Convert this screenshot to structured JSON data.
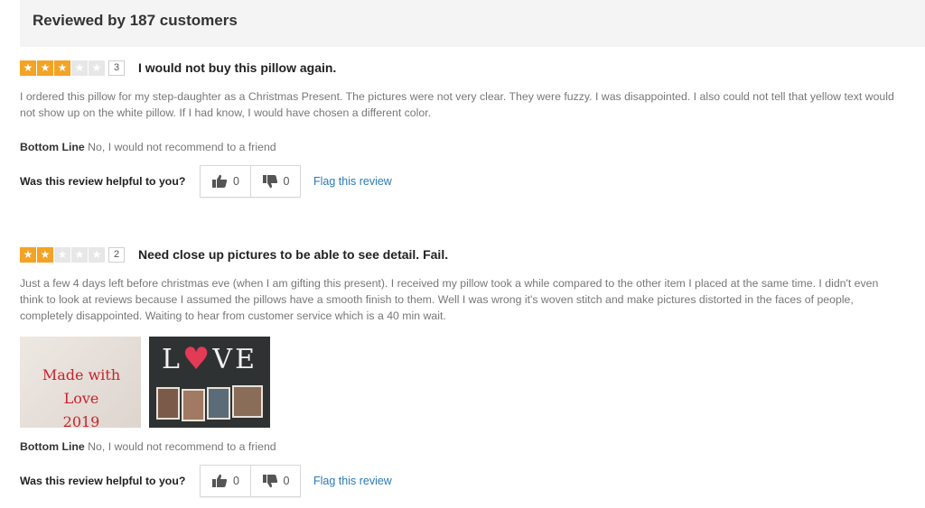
{
  "header": {
    "title": "Reviewed by 187 customers"
  },
  "reviews": [
    {
      "rating": 3,
      "max_rating": 5,
      "rating_label": "3",
      "title": "I would not buy this pillow again.",
      "body": "I ordered this pillow for my step-daughter as a Christmas Present. The pictures were not very clear. They were fuzzy. I was disappointed. I also could not tell that yellow text would not show up on the white pillow. If I had know, I would have chosen a different color.",
      "bottom_line_label": "Bottom Line",
      "bottom_line_text": "No, I would not recommend to a friend",
      "helpful_question": "Was this review helpful to you?",
      "upvotes": "0",
      "downvotes": "0",
      "flag_label": "Flag this review"
    },
    {
      "rating": 2,
      "max_rating": 5,
      "rating_label": "2",
      "title": "Need close up pictures to be able to see detail. Fail.",
      "body": "Just a few 4 days left before christmas eve (when I am gifting this present). I received my pillow took a while compared to the other item I placed at the same time. I didn't even think to look at reviews because I assumed the pillows have a smooth finish to them. Well I was wrong it's woven stitch and make pictures distorted in the faces of people, completely disappointed. Waiting to hear from customer service which is a 40 min wait.",
      "photos": [
        {
          "text_line1": "Made with Love",
          "text_line2": "2019"
        },
        {
          "word_left": "L",
          "word_right": "VE"
        }
      ],
      "bottom_line_label": "Bottom Line",
      "bottom_line_text": "No, I would not recommend to a friend",
      "helpful_question": "Was this review helpful to you?",
      "upvotes": "0",
      "downvotes": "0",
      "flag_label": "Flag this review"
    }
  ],
  "colors": {
    "star_filled": "#f3a325",
    "star_empty": "#e7e7e7",
    "link": "#2a7ab6",
    "header_bg": "#f4f4f4",
    "heart": "#e33a55",
    "photo_text": "#c8232b"
  },
  "icons": [
    "star-icon",
    "thumbs-up-icon",
    "thumbs-down-icon",
    "heart-icon"
  ]
}
